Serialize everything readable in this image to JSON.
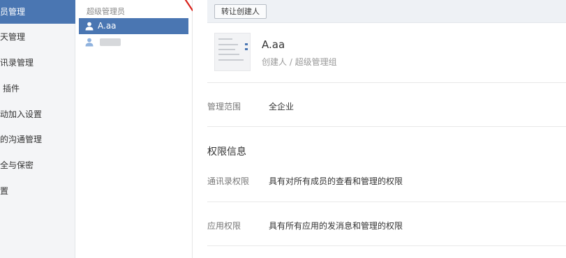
{
  "nav": {
    "items": [
      {
        "label": "员管理"
      },
      {
        "label": "天管理"
      },
      {
        "label": "讯录管理"
      },
      {
        "label": "插件"
      },
      {
        "label": "动加入设置"
      },
      {
        "label": "的沟通管理"
      },
      {
        "label": "全与保密"
      },
      {
        "label": "置"
      }
    ]
  },
  "admin_list": {
    "title": "超级管理员",
    "admins": [
      {
        "name": "A.aa"
      },
      {
        "name": ""
      }
    ]
  },
  "main": {
    "transfer_button": "转让创建人",
    "profile": {
      "name": "A.aa",
      "role": "创建人 / 超级管理组"
    },
    "scope": {
      "label": "管理范围",
      "value": "全企业"
    },
    "permissions": {
      "title": "权限信息",
      "contacts": {
        "label": "通讯录权限",
        "value": "具有对所有成员的查看和管理的权限"
      },
      "apps": {
        "label": "应用权限",
        "value": "具有所有应用的发消息和管理的权限"
      }
    }
  },
  "colors": {
    "accent": "#4a76b2",
    "annotation": "#d9231c"
  }
}
